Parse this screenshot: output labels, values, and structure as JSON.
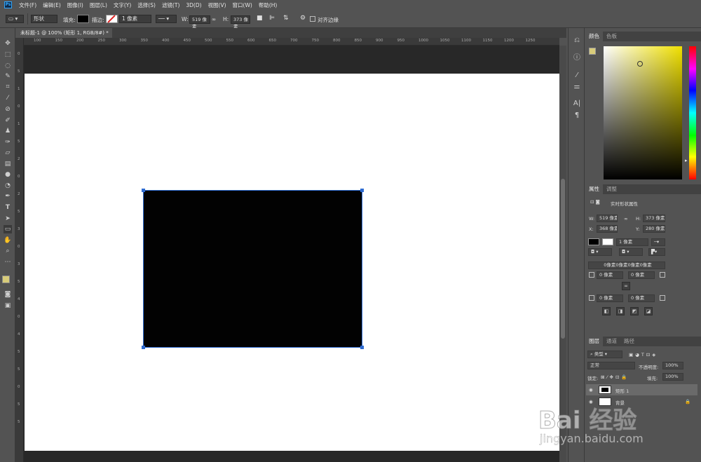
{
  "menu": {
    "logo": "Ps",
    "items": [
      "文件(F)",
      "编辑(E)",
      "图像(I)",
      "图层(L)",
      "文字(Y)",
      "选择(S)",
      "滤镜(T)",
      "3D(D)",
      "视图(V)",
      "窗口(W)",
      "帮助(H)"
    ]
  },
  "options": {
    "mode": "形状",
    "fill_label": "填充:",
    "stroke_label": "描边:",
    "stroke_width": "1 像素",
    "w_label": "W:",
    "w_value": "519 像素",
    "h_label": "H:",
    "h_value": "373 像素",
    "align_edges": "对齐边缘"
  },
  "document": {
    "tab_title": "未标题-1 @ 100% (矩形 1, RGB/8#) *",
    "ruler_ticks": [
      "100",
      "150",
      "200",
      "250",
      "300",
      "350",
      "400",
      "450",
      "500",
      "550",
      "600",
      "650",
      "700",
      "750",
      "800",
      "850",
      "900",
      "950",
      "1000",
      "1050",
      "1100",
      "1150",
      "1200",
      "1250"
    ],
    "left_ruler_ticks": [
      "0",
      "5",
      "1",
      "0",
      "1",
      "5",
      "2",
      "0",
      "2",
      "5",
      "3",
      "0",
      "3",
      "5",
      "4",
      "0",
      "4",
      "5",
      "5",
      "0",
      "5",
      "5"
    ]
  },
  "panels": {
    "color_tabs": [
      "颜色",
      "色板"
    ],
    "properties_tabs": [
      "属性",
      "调整"
    ],
    "properties_title": "实时形状属性",
    "w_label": "W:",
    "w_value": "519 像素",
    "h_label": "H:",
    "h_value": "373 像素",
    "x_label": "X:",
    "x_value": "368 像素",
    "y_label": "Y:",
    "y_value": "280 像素",
    "stroke_width": "1 像素",
    "corner_all": "0像素0像素0像素0像素",
    "corner_tl": "0 像素",
    "corner_tr": "0 像素",
    "corner_bl": "0 像素",
    "corner_br": "0 像素",
    "layers_tabs": [
      "图层",
      "通道",
      "路径"
    ],
    "kind_filter": "类型",
    "blend_mode": "正常",
    "opacity_label": "不透明度:",
    "opacity_value": "100%",
    "lock_label": "锁定:",
    "fill_label": "填充:",
    "fill_value": "100%",
    "layers": [
      "矩形 1",
      "背景"
    ]
  },
  "watermark": {
    "brand": "Bai 经验",
    "url": "jingyan.baidu.com"
  },
  "colors": {
    "foreground": "#d8cc7a",
    "background": "#ffffff",
    "accent": "#2e6bd1"
  }
}
